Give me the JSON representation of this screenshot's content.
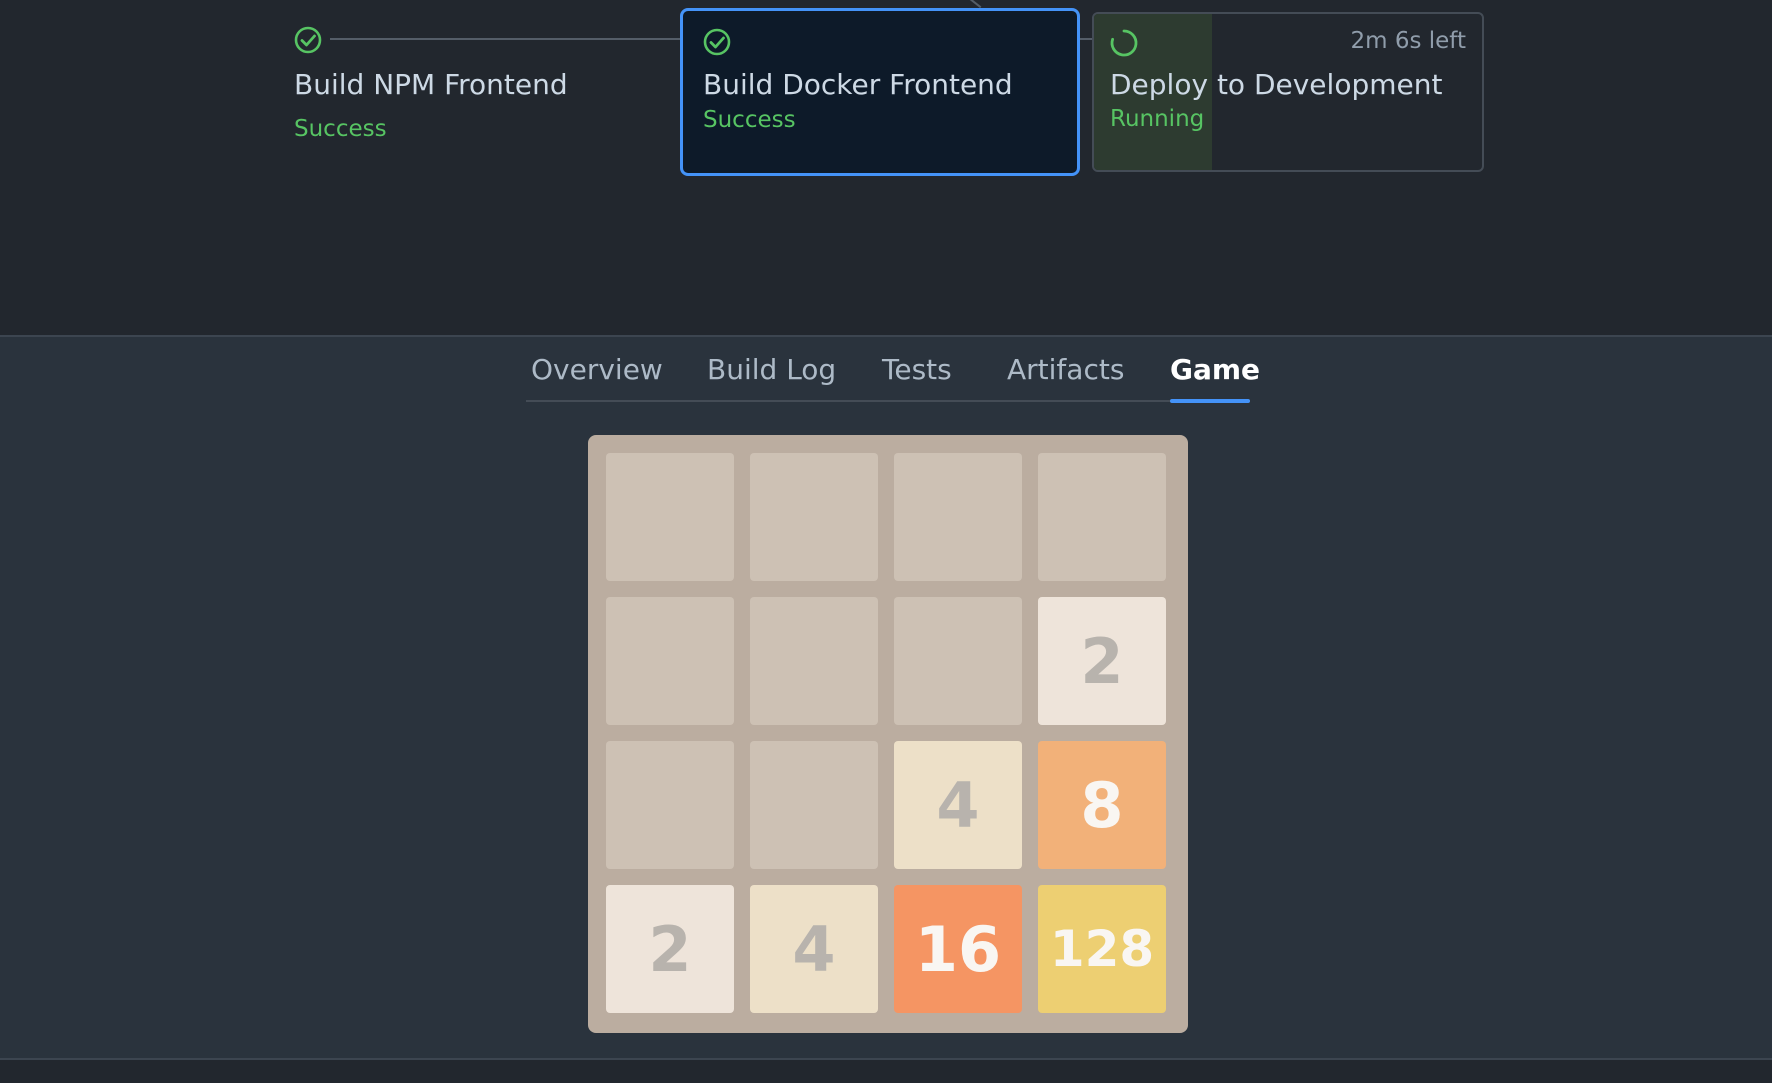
{
  "pipeline": {
    "stages": [
      {
        "name": "Build NPM Frontend",
        "status": "Success",
        "icon": "check-circle-icon"
      },
      {
        "name": "Build Docker Frontend",
        "status": "Success",
        "icon": "check-circle-icon"
      },
      {
        "name": "Deploy to Development",
        "status": "Running",
        "time_left": "2m 6s left",
        "icon": "spinner-icon",
        "progress": 0.3
      }
    ]
  },
  "tabs": [
    {
      "label": "Overview"
    },
    {
      "label": "Build Log"
    },
    {
      "label": "Tests"
    },
    {
      "label": "Artifacts"
    },
    {
      "label": "Game",
      "active": true
    }
  ],
  "game": {
    "board": [
      [
        "",
        "",
        "",
        ""
      ],
      [
        "",
        "",
        "",
        "2"
      ],
      [
        "",
        "",
        "4",
        "8"
      ],
      [
        "2",
        "4",
        "16",
        "128"
      ]
    ]
  },
  "colors": {
    "accent": "#4493f8",
    "success": "#57c463",
    "tile_2": "#eee4da",
    "tile_4": "#ede0c8",
    "tile_8": "#f2b179",
    "tile_16": "#f59563",
    "tile_128": "#edcf72"
  }
}
